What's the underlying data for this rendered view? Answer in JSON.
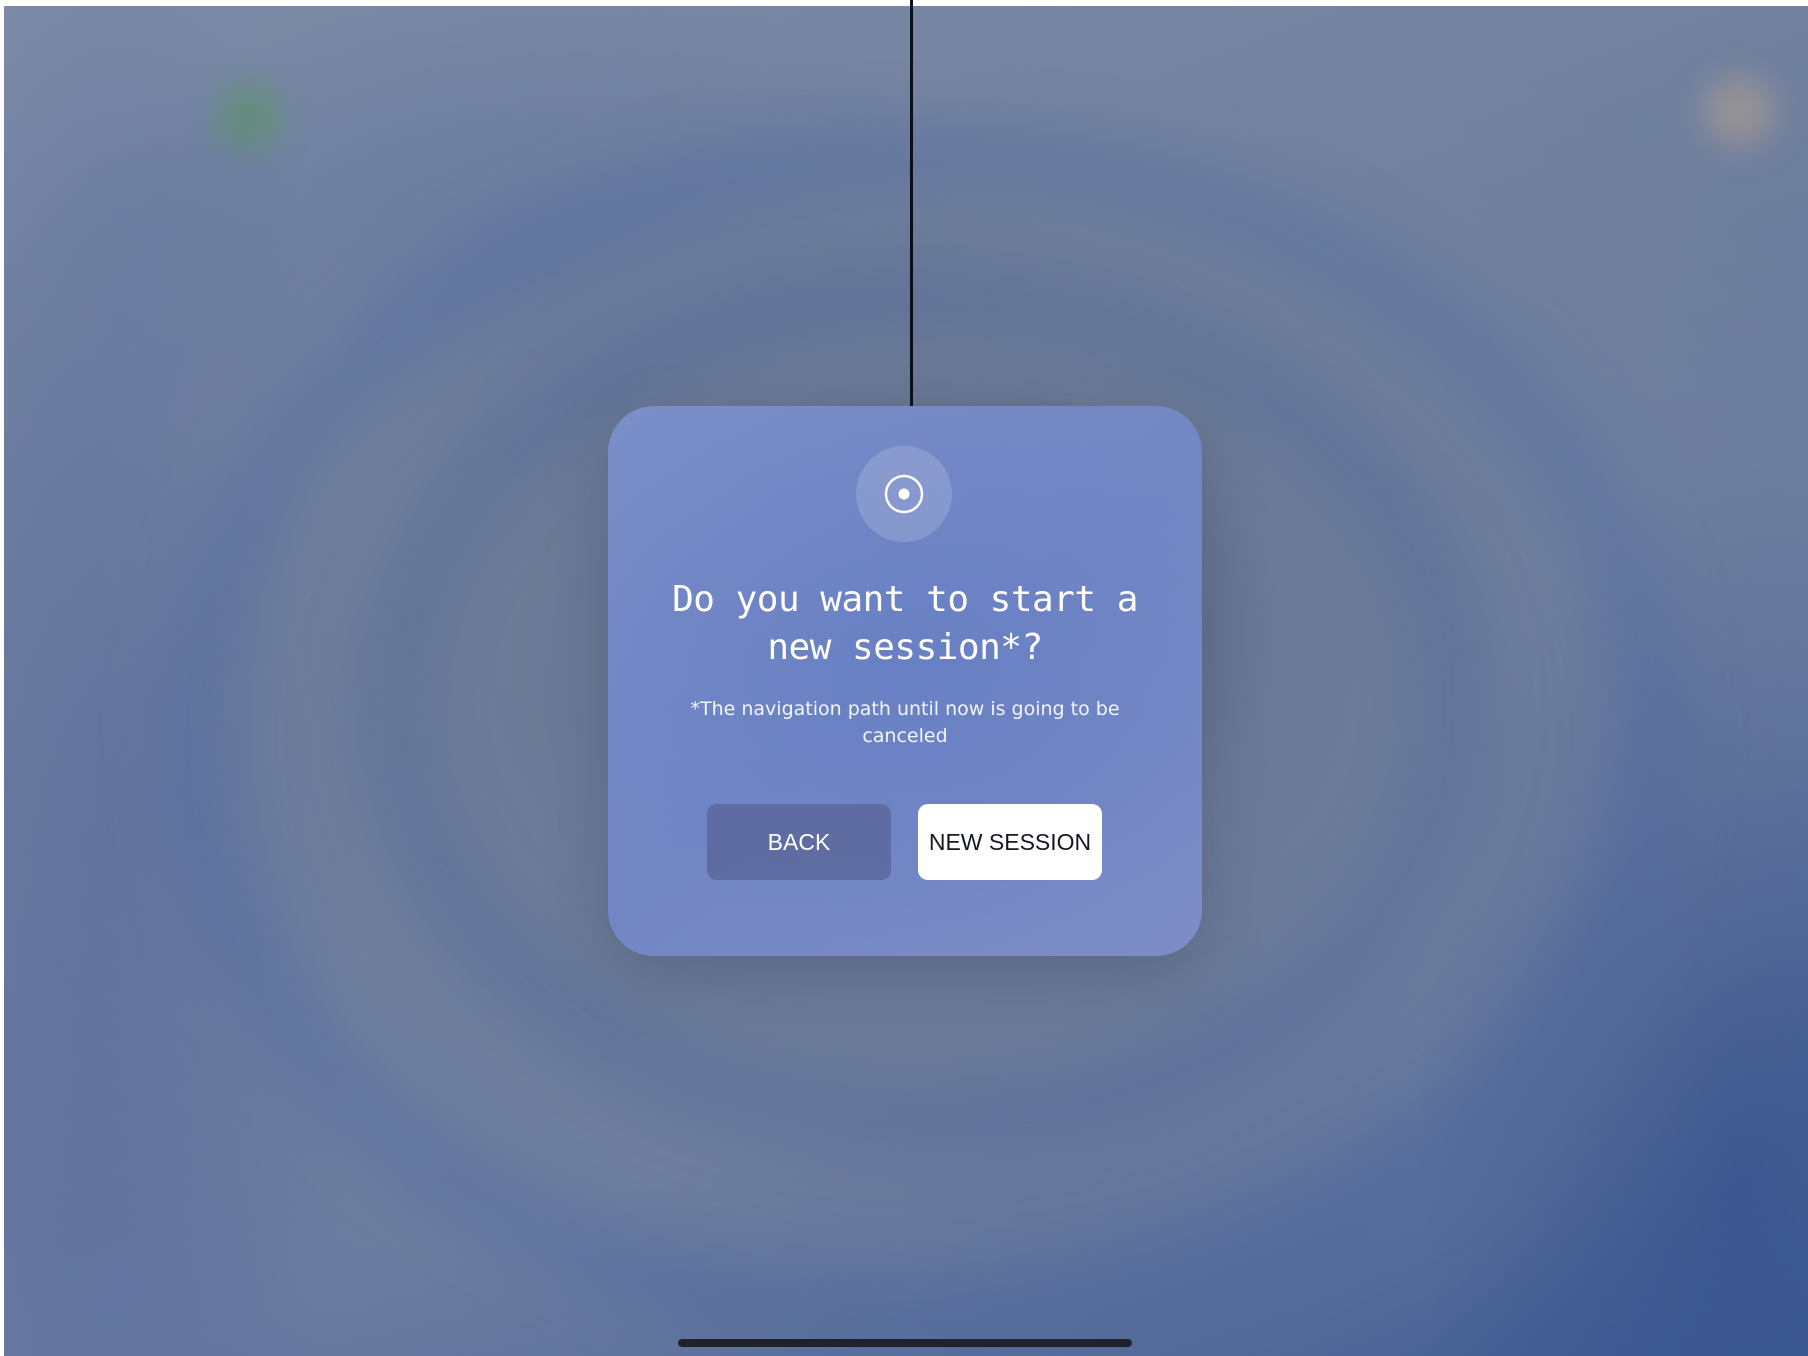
{
  "dialog": {
    "icon": "target-icon",
    "title": "Do you want to start a new session*?",
    "subtitle": "*The navigation path until now is going to be canceled",
    "back_label": "BACK",
    "new_session_label": "NEW SESSION"
  },
  "colors": {
    "dialog_background": "#7286c4",
    "back_button": "#5864a0",
    "new_session_button": "#ffffff",
    "tether": "#0c0f1a"
  }
}
